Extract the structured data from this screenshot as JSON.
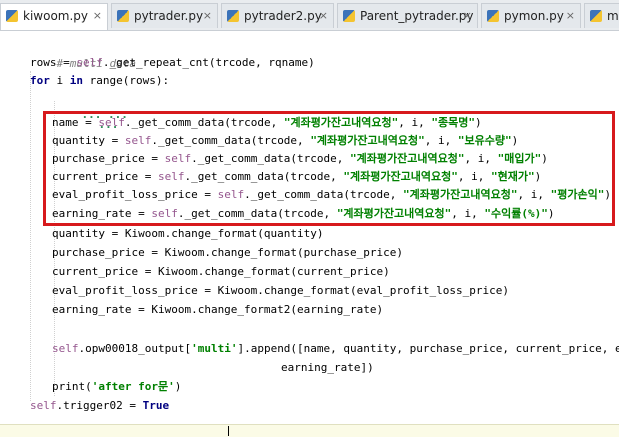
{
  "tabs": [
    {
      "label": "kiwoom.py",
      "active": true
    },
    {
      "label": "pytrader.py",
      "active": false
    },
    {
      "label": "pytrader2.py",
      "active": false
    },
    {
      "label": "Parent_pytrader.py",
      "active": false
    },
    {
      "label": "pymon.py",
      "active": false
    },
    {
      "label": "my",
      "active": false
    }
  ],
  "close_glyph": "×",
  "code": {
    "comment": "# multi data",
    "rows_line": "rows = ",
    "rows_call": "._get_repeat_cnt(trcode, rqname)",
    "for_kw": "for",
    "for_mid": " i ",
    "in_kw": "in",
    "for_rest": " range(rows):",
    "dots1": "... ...",
    "dots2": "...",
    "self": "self",
    "call": "._get_comm_data(trcode, ",
    "tr_str": "\"계좌평가잔고내역요청\"",
    "mid": ", i, ",
    "end": ")",
    "fields": [
      {
        "var": "name",
        "key": "\"종목명\""
      },
      {
        "var": "quantity",
        "key": "\"보유수량\""
      },
      {
        "var": "purchase_price",
        "key": "\"매입가\""
      },
      {
        "var": "current_price",
        "key": "\"현재가\""
      },
      {
        "var": "eval_profit_loss_price",
        "key": "\"평가손익\""
      },
      {
        "var": "earning_rate",
        "key": "\"수익률(%)\""
      }
    ],
    "format_lines": [
      "quantity = Kiwoom.change_format(quantity)",
      "purchase_price = Kiwoom.change_format(purchase_price)",
      "current_price = Kiwoom.change_format(current_price)",
      "eval_profit_loss_price = Kiwoom.change_format(eval_profit_loss_price)",
      "earning_rate = Kiwoom.change_format2(earning_rate)"
    ],
    "append_pre": ".opw00018_output[",
    "append_key": "'multi'",
    "append_rest": "].append([name, quantity, purchase_price, current_price, eval_profit_loss_price,",
    "append_cont": "earning_rate])",
    "print_pre": "print(",
    "print_str": "'after for문'",
    "print_post": ")",
    "trigger_pre": ".trigger02 = ",
    "trigger_val": "True"
  },
  "colors": {
    "highlight": "#d7191c",
    "keyword": "#000080",
    "string": "#008000",
    "self": "#94558d"
  }
}
